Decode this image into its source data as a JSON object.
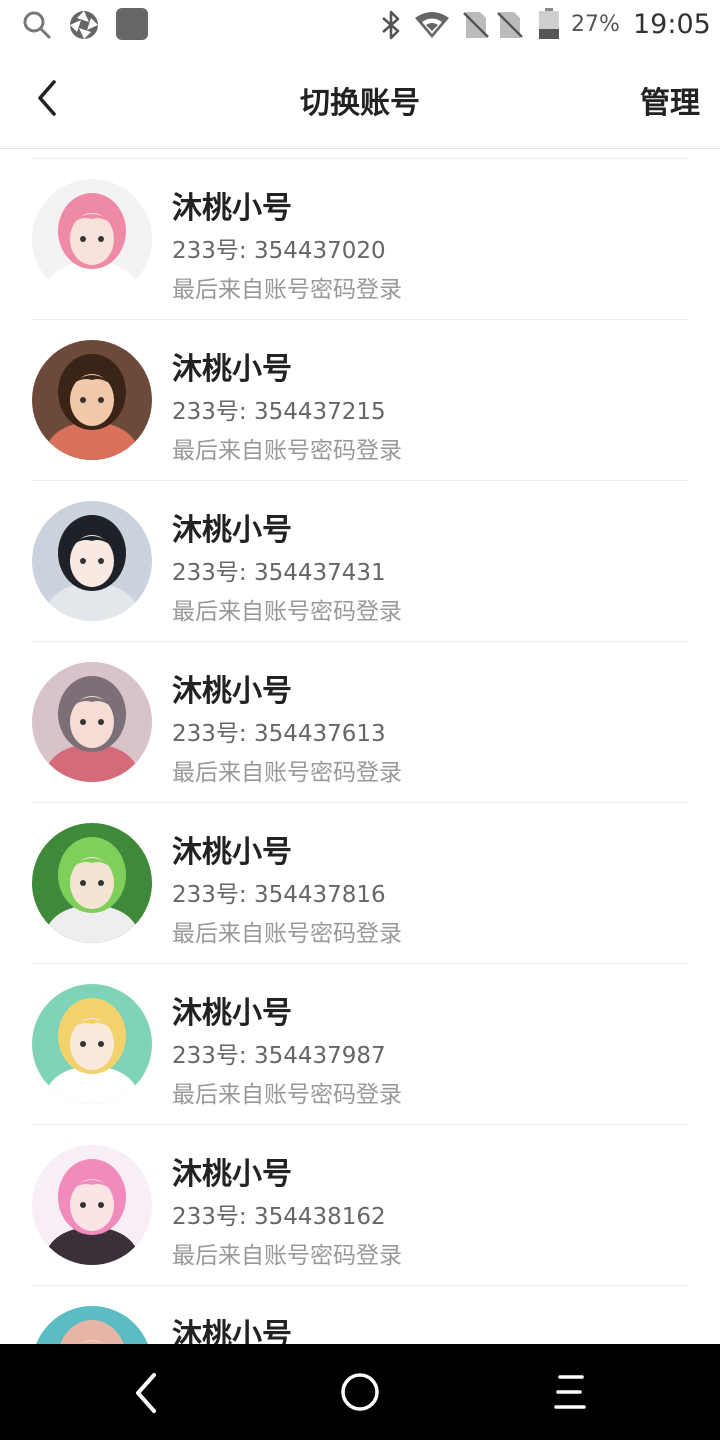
{
  "status_bar": {
    "battery_percent": "27%",
    "time": "19:05",
    "icons": [
      "search-icon",
      "aperture-icon",
      "app-square-icon",
      "bluetooth-icon",
      "wifi-icon",
      "no-sim-icon",
      "no-sim-icon",
      "battery-icon"
    ]
  },
  "header": {
    "back_icon": "chevron-left-icon",
    "title": "切换账号",
    "manage_label": "管理"
  },
  "accounts": [
    {
      "name": "沐桃小号",
      "id_text": "233号: 354437020",
      "login_text": "最后来自账号密码登录",
      "avatar": {
        "bg": "#f3f3f6",
        "hair": "#ef8aa6",
        "skin": "#f7e2dc",
        "shirt": "#ffffff"
      }
    },
    {
      "name": "沐桃小号",
      "id_text": "233号: 354437215",
      "login_text": "最后来自账号密码登录",
      "avatar": {
        "bg": "#6b4a3a",
        "hair": "#3a2418",
        "skin": "#f1c9a8",
        "shirt": "#d9705a"
      }
    },
    {
      "name": "沐桃小号",
      "id_text": "233号: 354437431",
      "login_text": "最后来自账号密码登录",
      "avatar": {
        "bg": "#c9d2dd",
        "hair": "#1f2128",
        "skin": "#f8eae2",
        "shirt": "#e3e6ea"
      }
    },
    {
      "name": "沐桃小号",
      "id_text": "233号: 354437613",
      "login_text": "最后来自账号密码登录",
      "avatar": {
        "bg": "#d8c4c8",
        "hair": "#7d6f78",
        "skin": "#f6dcd5",
        "shirt": "#d56b78"
      }
    },
    {
      "name": "沐桃小号",
      "id_text": "233号: 354437816",
      "login_text": "最后来自账号密码登录",
      "avatar": {
        "bg": "#3f8a3a",
        "hair": "#7fd05a",
        "skin": "#f4e4d4",
        "shirt": "#eeeeee"
      }
    },
    {
      "name": "沐桃小号",
      "id_text": "233号: 354437987",
      "login_text": "最后来自账号密码登录",
      "avatar": {
        "bg": "#7fd3b8",
        "hair": "#f2d26a",
        "skin": "#fbe9dc",
        "shirt": "#ffffff"
      }
    },
    {
      "name": "沐桃小号",
      "id_text": "233号: 354438162",
      "login_text": "最后来自账号密码登录",
      "avatar": {
        "bg": "#f7eef6",
        "hair": "#f08bbb",
        "skin": "#fbe4e4",
        "shirt": "#3b2f3a"
      }
    },
    {
      "name": "沐桃小号",
      "id_text": "",
      "login_text": "",
      "avatar": {
        "bg": "#5bbcc4",
        "hair": "#e6b5a6",
        "skin": "#f5dccd",
        "shirt": "#ffffff"
      }
    }
  ],
  "nav_bar": {
    "icons": [
      "back-triangle-icon",
      "home-circle-icon",
      "menu-lines-icon"
    ]
  }
}
